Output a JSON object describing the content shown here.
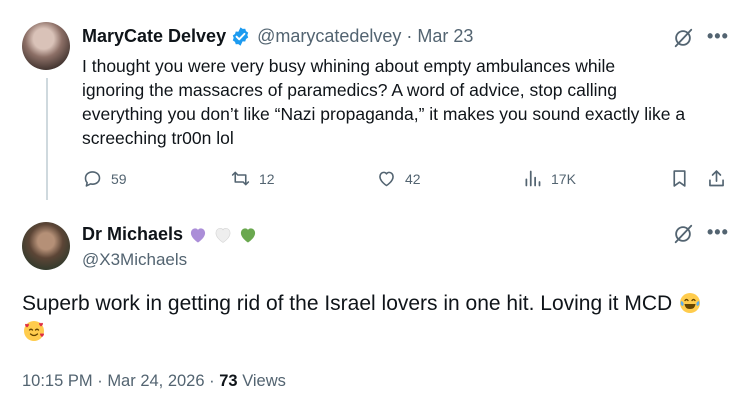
{
  "reply": {
    "author_name": "MaryCate Delvey",
    "handle": "@marycatedelvey",
    "date": "Mar 23",
    "text_lines": [
      "I thought you were very busy whining about empty ambulances while",
      "ignoring the massacres of paramedics? A word of advice, stop calling",
      "everything you don’t like “Nazi propaganda,” it makes you sound exactly like a",
      "screeching tr00n lol"
    ],
    "replies_count": "59",
    "reposts_count": "12",
    "likes_count": "42",
    "views_count": "17K",
    "more_label": "•••"
  },
  "main_post": {
    "author_name": "Dr Michaels",
    "handle": "@X3Michaels",
    "text_line1": "Superb work in getting rid of the Israel lovers in one hit. Loving it MCD",
    "time": "10:15 PM",
    "date": "Mar 24, 2026",
    "views_number": "73",
    "views_label": "Views",
    "more_label": "•••"
  },
  "icons": [
    "verified-badge-icon",
    "grok-icon",
    "more-icon",
    "reply-icon",
    "repost-icon",
    "like-icon",
    "analytics-icon",
    "bookmark-icon",
    "share-icon",
    "purple-heart-icon",
    "white-heart-icon",
    "green-heart-icon",
    "tears-of-joy-emoji",
    "smiling-face-with-hearts-emoji"
  ],
  "colors": {
    "accent": "#1d9bf0",
    "secondary_text": "#536471",
    "primary_text": "#0f1419"
  }
}
